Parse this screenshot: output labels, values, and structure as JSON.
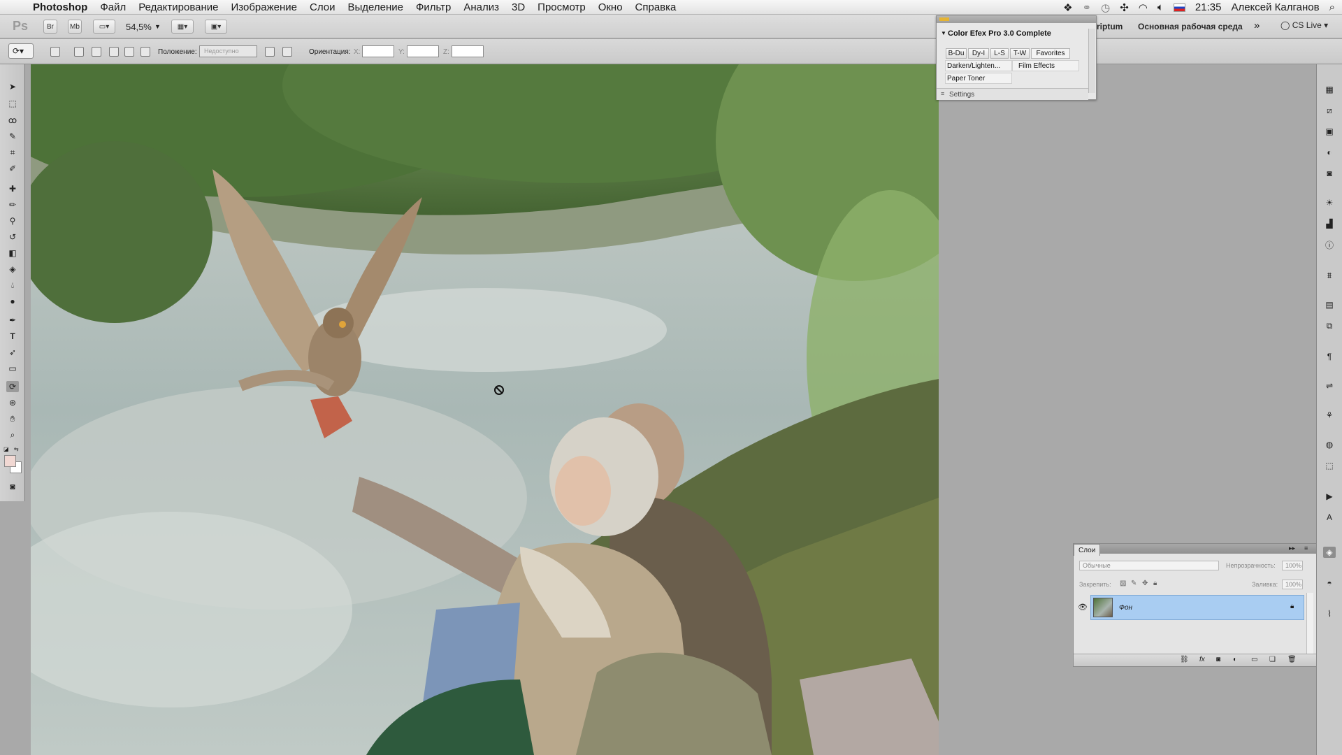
{
  "menubar": {
    "app_name": "Photoshop",
    "items": [
      "Файл",
      "Редактирование",
      "Изображение",
      "Слои",
      "Выделение",
      "Фильтр",
      "Анализ",
      "3D",
      "Просмотр",
      "Окно",
      "Справка"
    ],
    "clock": "21:35",
    "user": "Алексей Калганов"
  },
  "appbar": {
    "logo": "Ps",
    "br_label": "Br",
    "mb_label": "Mb",
    "zoom": "54,5%",
    "workspace_partial": "ript​um",
    "workspace": "Основная рабочая среда",
    "cs_live": "CS Live"
  },
  "options": {
    "position_label": "Положение:",
    "position_value": "Недоступно",
    "orientation_label": "Ориентация:",
    "x_label": "X:",
    "y_label": "Y:",
    "z_label": "Z:"
  },
  "efex": {
    "title": "Color Efex Pro 3.0 Complete",
    "tabs": [
      "B-Du",
      "Dy-I",
      "L-S",
      "T-W",
      "Favorites"
    ],
    "filters": [
      "Darken/Lighten...",
      "Film Effects",
      "Paper Toner"
    ],
    "settings": "Settings"
  },
  "layers": {
    "tab": "Слои",
    "blend_mode": "Обычные",
    "opacity_label": "Непрозрачность:",
    "opacity_value": "100%",
    "lock_label": "Закрепить:",
    "fill_label": "Заливка:",
    "fill_value": "100%",
    "layer_name": "Фон"
  },
  "colors": {
    "accent": "#a9cdf2",
    "menubar": "#ececec",
    "workspace": "#a9a9a9"
  }
}
